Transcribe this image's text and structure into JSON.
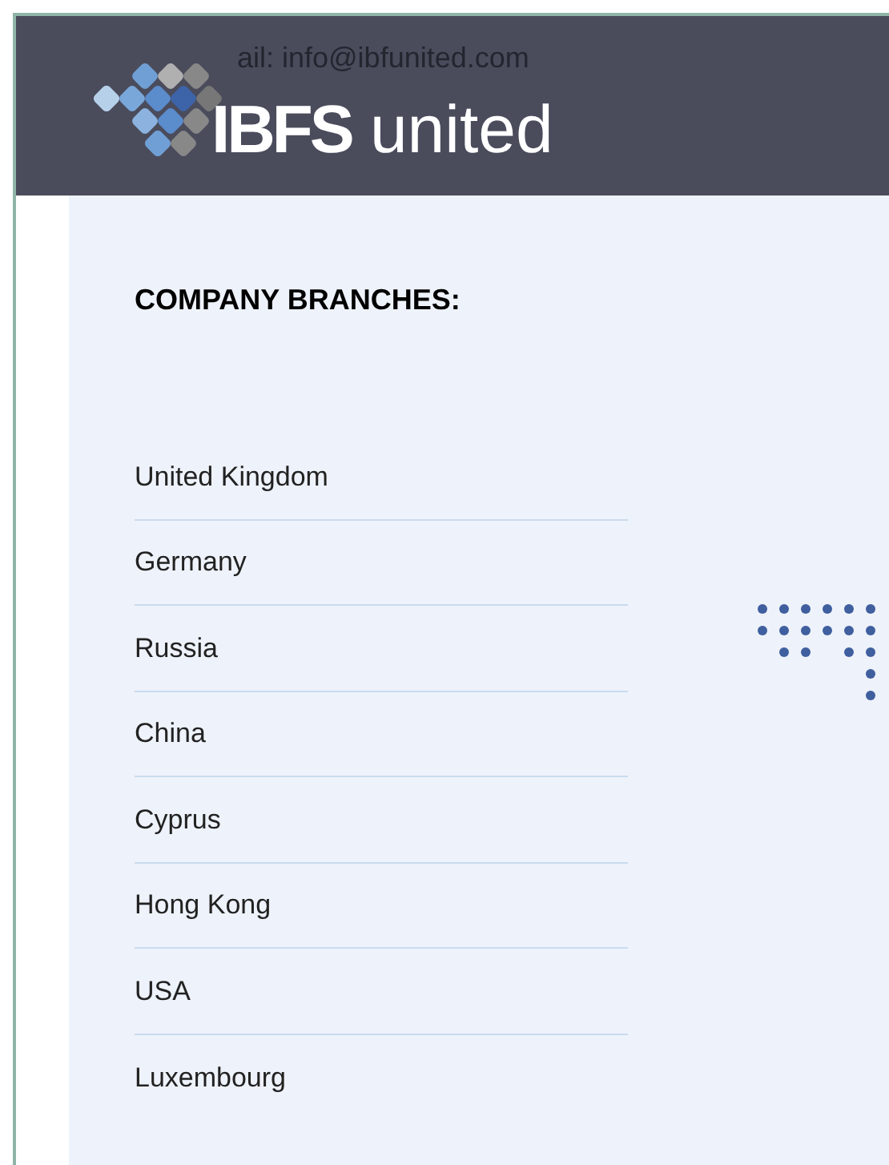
{
  "header": {
    "logo": {
      "bold": "IBFS",
      "light": "united"
    },
    "contact_lines": [
      "ail: info@ibfunited.com"
    ]
  },
  "branches": {
    "title": "COMPANY BRANCHES:",
    "items": [
      "United Kingdom",
      "Germany",
      "Russia",
      "China",
      "Cyprus",
      "Hong Kong",
      "USA",
      "Luxembourg"
    ]
  }
}
